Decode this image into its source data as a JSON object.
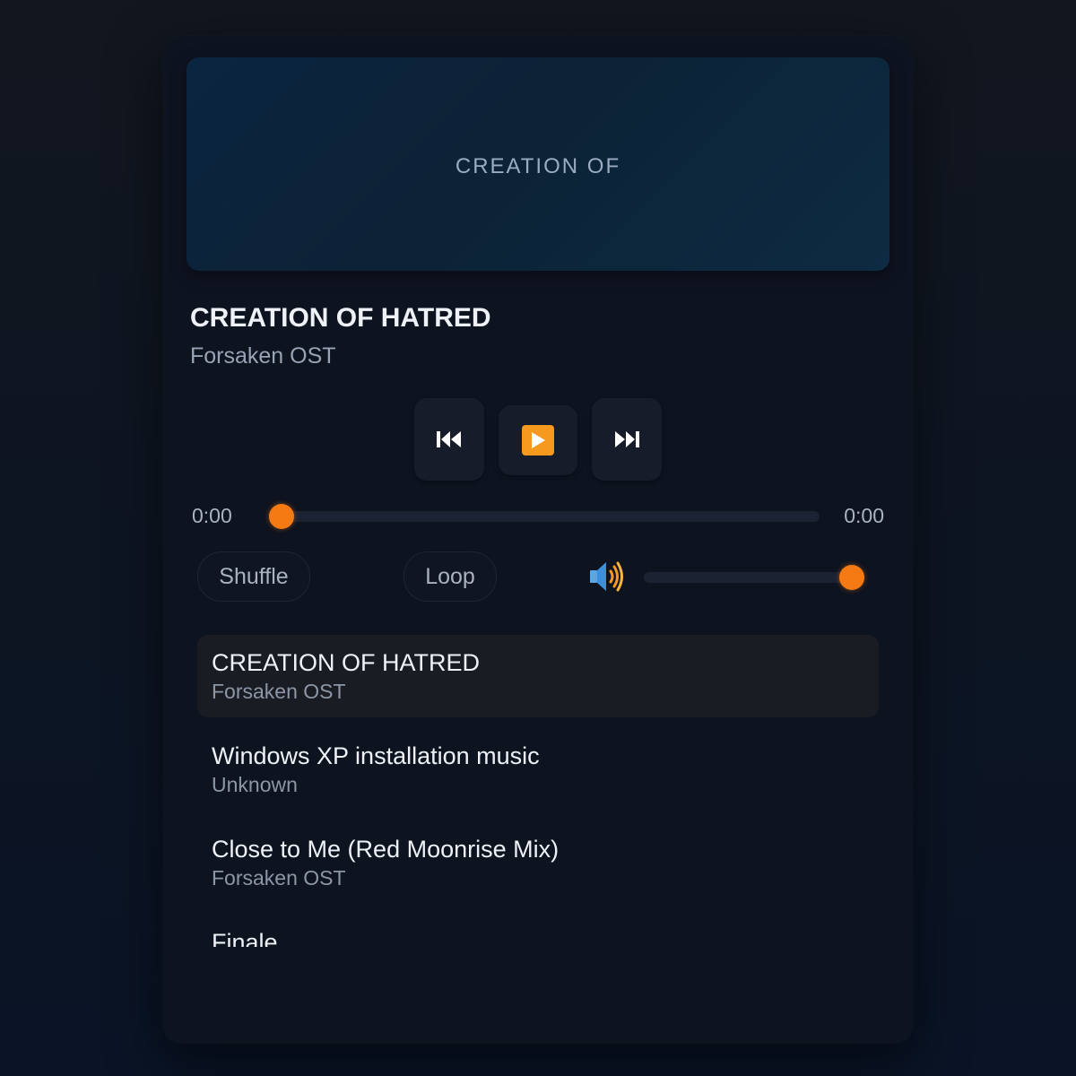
{
  "album_art": {
    "label": "CREATION OF"
  },
  "now_playing": {
    "title": "CREATION OF HATRED",
    "artist": "Forsaken OST"
  },
  "controls": {
    "prev_icon": "previous-track-icon",
    "play_icon": "play-icon",
    "next_icon": "next-track-icon"
  },
  "progress": {
    "current": "0:00",
    "duration": "0:00",
    "fraction": 0
  },
  "options": {
    "shuffle_label": "Shuffle",
    "loop_label": "Loop"
  },
  "volume": {
    "icon": "speaker-icon",
    "level": 1.0
  },
  "playlist": [
    {
      "title": "CREATION OF HATRED",
      "artist": "Forsaken OST",
      "active": true
    },
    {
      "title": "Windows XP installation music",
      "artist": "Unknown",
      "active": false
    },
    {
      "title": "Close to Me (Red Moonrise Mix)",
      "artist": "Forsaken OST",
      "active": false
    },
    {
      "title": "Finale",
      "artist": "",
      "active": false
    }
  ],
  "colors": {
    "accent": "#f57a13",
    "play_button": "#f59a1e",
    "background": "#0e1320"
  }
}
